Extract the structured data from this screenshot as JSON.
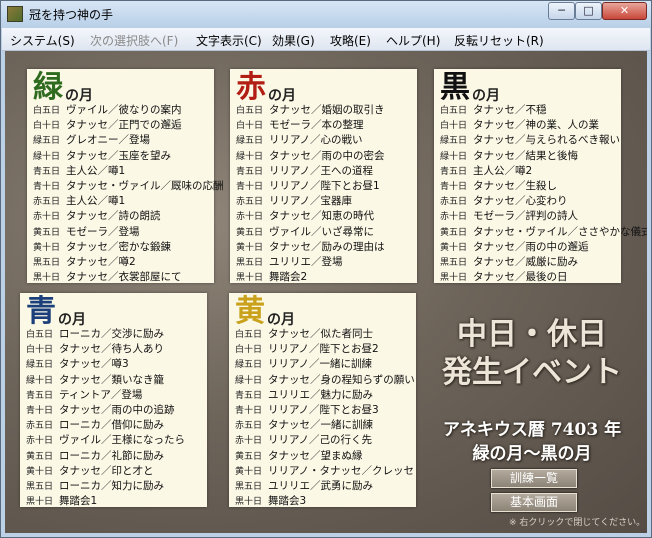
{
  "window": {
    "title": "冠を持つ神の手",
    "min_glyph": "─",
    "max_glyph": "□",
    "close_glyph": "✕"
  },
  "menu": [
    "システム(S)",
    "次の選択肢へ(F)",
    "文字表示(C)",
    "効果(G)",
    "攻略(E)",
    "ヘルプ(H)",
    "反転リセット(R)"
  ],
  "colors": {
    "green": "#2e6b1f",
    "red": "#b21d14",
    "black": "#111111",
    "blue": "#1b3f7a",
    "yellow": "#c9a11a"
  },
  "cards": [
    {
      "kanji": "緑",
      "sub": "の月",
      "color": "green",
      "rows": [
        {
          "d": "白五日",
          "t": "ヴァイル／彼なりの案内"
        },
        {
          "d": "白十日",
          "t": "タナッセ／正門での邂逅"
        },
        {
          "d": "緑五日",
          "t": "グレオニー／登場"
        },
        {
          "d": "緑十日",
          "t": "タナッセ／玉座を望み"
        },
        {
          "d": "青五日",
          "t": "主人公／噂1"
        },
        {
          "d": "青十日",
          "t": "タナッセ・ヴァイル／厩味の応酬"
        },
        {
          "d": "赤五日",
          "t": "主人公／噂1"
        },
        {
          "d": "赤十日",
          "t": "タナッセ／詩の朗読"
        },
        {
          "d": "黄五日",
          "t": "モゼーラ／登場"
        },
        {
          "d": "黄十日",
          "t": "タナッセ／密かな鍛錬"
        },
        {
          "d": "黒五日",
          "t": "タナッセ／噂2"
        },
        {
          "d": "黒十日",
          "t": "タナッセ／衣裳部屋にて"
        }
      ]
    },
    {
      "kanji": "赤",
      "sub": "の月",
      "color": "red",
      "rows": [
        {
          "d": "白五日",
          "t": "タナッセ／婚姻の取引き"
        },
        {
          "d": "白十日",
          "t": "モゼーラ／本の整理"
        },
        {
          "d": "緑五日",
          "t": "リリアノ／心の戦い"
        },
        {
          "d": "緑十日",
          "t": "タナッセ／雨の中の密会"
        },
        {
          "d": "青五日",
          "t": "リリアノ／王への道程"
        },
        {
          "d": "青十日",
          "t": "リリアノ／陛下とお昼1"
        },
        {
          "d": "赤五日",
          "t": "リリアノ／宝器庫"
        },
        {
          "d": "赤十日",
          "t": "タナッセ／知恵の時代"
        },
        {
          "d": "黄五日",
          "t": "ヴァイル／いざ尋常に"
        },
        {
          "d": "黄十日",
          "t": "タナッセ／励みの理由は"
        },
        {
          "d": "黒五日",
          "t": "ユリリエ／登場"
        },
        {
          "d": "黒十日",
          "t": "舞踏会2"
        }
      ]
    },
    {
      "kanji": "黒",
      "sub": "の月",
      "color": "black",
      "rows": [
        {
          "d": "白五日",
          "t": "タナッセ／不穏"
        },
        {
          "d": "白十日",
          "t": "タナッセ／神の業、人の業"
        },
        {
          "d": "緑五日",
          "t": "タナッセ／与えられるべき報い"
        },
        {
          "d": "緑十日",
          "t": "タナッセ／結果と後悔"
        },
        {
          "d": "青五日",
          "t": "主人公／噂2"
        },
        {
          "d": "青十日",
          "t": "タナッセ／生殺し"
        },
        {
          "d": "赤五日",
          "t": "タナッセ／心変わり"
        },
        {
          "d": "赤十日",
          "t": "モゼーラ／評判の詩人"
        },
        {
          "d": "黄五日",
          "t": "タナッセ・ヴァイル／ささやかな儀式"
        },
        {
          "d": "黄十日",
          "t": "タナッセ／雨の中の邂逅"
        },
        {
          "d": "黒五日",
          "t": "タナッセ／威厳に励み"
        },
        {
          "d": "黒十日",
          "t": "タナッセ／最後の日"
        }
      ]
    },
    {
      "kanji": "青",
      "sub": "の月",
      "color": "blue",
      "rows": [
        {
          "d": "白五日",
          "t": "ローニカ／交渉に励み"
        },
        {
          "d": "白十日",
          "t": "タナッセ／待ち人あり"
        },
        {
          "d": "緑五日",
          "t": "タナッセ／噂3"
        },
        {
          "d": "緑十日",
          "t": "タナッセ／類いなき籠"
        },
        {
          "d": "青五日",
          "t": "ティントア／登場"
        },
        {
          "d": "青十日",
          "t": "タナッセ／雨の中の追跡"
        },
        {
          "d": "赤五日",
          "t": "ローニカ／借仰に励み"
        },
        {
          "d": "赤十日",
          "t": "ヴァイル／王様になったら"
        },
        {
          "d": "黄五日",
          "t": "ローニカ／礼節に励み"
        },
        {
          "d": "黄十日",
          "t": "タナッセ／印と才と"
        },
        {
          "d": "黒五日",
          "t": "ローニカ／知力に励み"
        },
        {
          "d": "黒十日",
          "t": "舞踏会1"
        }
      ]
    },
    {
      "kanji": "黄",
      "sub": "の月",
      "color": "yellow",
      "rows": [
        {
          "d": "白五日",
          "t": "タナッセ／似た者同士"
        },
        {
          "d": "白十日",
          "t": "リリアノ／陛下とお昼2"
        },
        {
          "d": "緑五日",
          "t": "リリアノ／一緒に訓練"
        },
        {
          "d": "緑十日",
          "t": "タナッセ／身の程知らずの願い"
        },
        {
          "d": "青五日",
          "t": "ユリリエ／魅力に励み"
        },
        {
          "d": "青十日",
          "t": "リリアノ／陛下とお昼3"
        },
        {
          "d": "赤五日",
          "t": "タナッセ／一緒に訓練"
        },
        {
          "d": "赤十日",
          "t": "リリアノ／己の行く先"
        },
        {
          "d": "黄五日",
          "t": "タナッセ／望まぬ縁"
        },
        {
          "d": "黄十日",
          "t": "リリアノ・タナッセ／クレッセ"
        },
        {
          "d": "黒五日",
          "t": "ユリリエ／武勇に励み"
        },
        {
          "d": "黒十日",
          "t": "舞踏会3"
        }
      ]
    }
  ],
  "info": {
    "title_line1": "中日・休日",
    "title_line2": "発生イベント",
    "era": "アネキウス暦 7403 年",
    "range": "緑の月～黒の月",
    "btn_training": "訓練一覧",
    "btn_basic": "基本画面",
    "hint": "※ 右クリックで閉じてください。"
  }
}
